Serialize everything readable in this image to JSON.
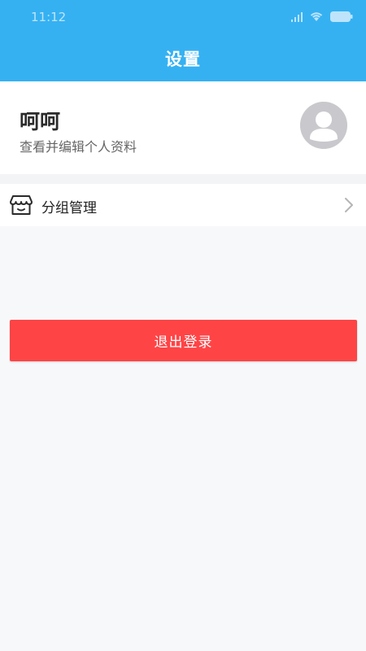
{
  "status_bar": {
    "time": "11:12",
    "icons": [
      "signal-icon",
      "wifi-icon",
      "battery-icon"
    ]
  },
  "header": {
    "title": "设置",
    "background": "#35b1f2"
  },
  "profile": {
    "name": "呵呵",
    "subtitle": "查看并编辑个人资料",
    "avatar_icon": "user-avatar-icon"
  },
  "menu": {
    "items": [
      {
        "label": "分组管理",
        "icon": "store-icon",
        "chevron": "chevron-right-icon"
      }
    ]
  },
  "actions": {
    "logout_label": "退出登录",
    "logout_color": "#ff4446"
  }
}
